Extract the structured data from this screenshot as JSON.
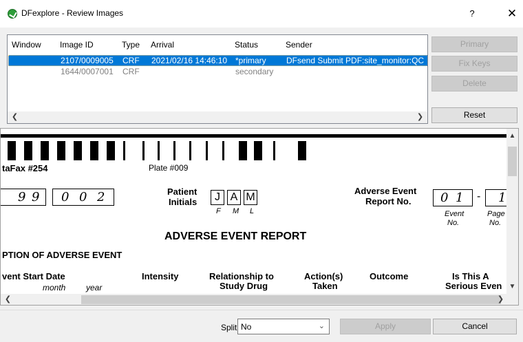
{
  "window": {
    "title": "DFexplore - Review Images",
    "help_label": "?",
    "close_label": "✕"
  },
  "image_list": {
    "columns": [
      "Window",
      "Image ID",
      "Type",
      "Arrival",
      "Status",
      "Sender"
    ],
    "rows": [
      {
        "window": "",
        "image_id": "2107/0009005",
        "type": "CRF",
        "arrival": "2021/02/16 14:46:10",
        "status": "*primary",
        "sender": "DFsend Submit PDF:site_monitor:QC"
      },
      {
        "window": "",
        "image_id": "1644/0007001",
        "type": "CRF",
        "arrival": "",
        "status": "secondary",
        "sender": ""
      }
    ]
  },
  "side_buttons": {
    "primary": "Primary",
    "fix_keys": "Fix Keys",
    "delete": "Delete",
    "reset": "Reset"
  },
  "form_image": {
    "datafax": "taFax #254",
    "plate": "Plate #009",
    "site_digits": [
      "9",
      "9"
    ],
    "patient_digits": [
      "0",
      "0",
      "2"
    ],
    "patient_initials_label_1": "Patient",
    "patient_initials_label_2": "Initials",
    "initials": [
      "J",
      "A",
      "M"
    ],
    "initials_sub": [
      "F",
      "M",
      "L"
    ],
    "ae_report_label_1": "Adverse Event",
    "ae_report_label_2": "Report No.",
    "event_digits": [
      "0",
      "1"
    ],
    "dash": "-",
    "page_digit": "1",
    "event_no_1": "Event",
    "event_no_2": "No.",
    "page_no_1": "Page",
    "page_no_2": "No.",
    "heading": "ADVERSE EVENT REPORT",
    "section": "PTION OF ADVERSE EVENT",
    "col_start": "vent Start Date",
    "col_month": "month",
    "col_year": "year",
    "col_intensity": "Intensity",
    "col_relationship_1": "Relationship to",
    "col_relationship_2": "Study Drug",
    "col_action_1": "Action(s)",
    "col_action_2": "Taken",
    "col_outcome": "Outcome",
    "col_serious_1": "Is This A",
    "col_serious_2": "Serious Even"
  },
  "bottom": {
    "split_label": "Split",
    "split_value": "No",
    "apply": "Apply",
    "cancel": "Cancel"
  },
  "colors": {
    "selection": "#0078d7",
    "app_icon": "#2e9e3a"
  }
}
